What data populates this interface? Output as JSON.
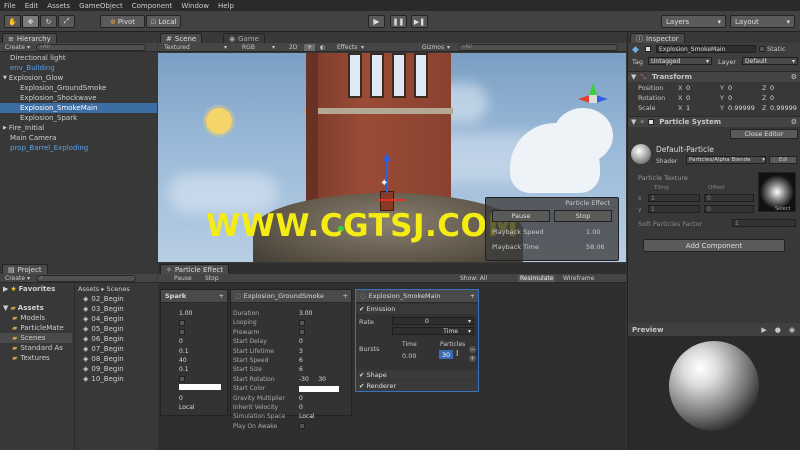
{
  "menu": [
    "File",
    "Edit",
    "Assets",
    "GameObject",
    "Component",
    "Window",
    "Help"
  ],
  "toolbar": {
    "pivot": "Pivot",
    "local": "Local",
    "layers": "Layers",
    "layout": "Layout"
  },
  "hierarchy": {
    "tab": "Hierarchy",
    "create": "Create",
    "search": "All",
    "items": [
      {
        "label": "Directional light",
        "indent": 0,
        "sel": false,
        "blue": false
      },
      {
        "label": "env_Building",
        "indent": 0,
        "sel": false,
        "blue": true
      },
      {
        "label": "Explosion_Glow",
        "indent": 0,
        "sel": false,
        "blue": false,
        "arrow": "▼"
      },
      {
        "label": "Explosion_GroundSmoke",
        "indent": 1,
        "sel": false,
        "blue": false
      },
      {
        "label": "Explosion_Shockwave",
        "indent": 1,
        "sel": false,
        "blue": false
      },
      {
        "label": "Explosion_SmokeMain",
        "indent": 1,
        "sel": true,
        "blue": false
      },
      {
        "label": "Explosion_Spark",
        "indent": 1,
        "sel": false,
        "blue": false
      },
      {
        "label": "Fire_Initial",
        "indent": 0,
        "sel": false,
        "blue": false,
        "arrow": "▶"
      },
      {
        "label": "Main Camera",
        "indent": 0,
        "sel": false,
        "blue": false
      },
      {
        "label": "prop_Barrel_Exploding",
        "indent": 0,
        "sel": false,
        "blue": true
      }
    ]
  },
  "scene": {
    "tab_scene": "Scene",
    "tab_game": "Game",
    "shading": "Textured",
    "render": "RGB",
    "mode2d": "2D",
    "effects": "Effects",
    "gizmos": "Gizmos",
    "search": "All",
    "watermark": "WWW.CGTSJ.COM",
    "overlay": {
      "title": "Particle Effect",
      "pause": "Pause",
      "stop": "Stop",
      "speed_label": "Playback Speed",
      "speed": "1.00",
      "time_label": "Playback Time",
      "time": "58.06"
    }
  },
  "project": {
    "tab": "Project",
    "create": "Create",
    "favorites": "Favorites",
    "assets": "Assets",
    "tree": [
      "Models",
      "ParticleMate",
      "Scenes",
      "Standard As",
      "Textures"
    ],
    "breadcrumb": "Assets ▸ Scenes",
    "scenes": [
      "02_Begin",
      "03_Begin",
      "04_Begin",
      "05_Begin",
      "06_Begin",
      "07_Begin",
      "08_Begin",
      "09_Begin",
      "10_Begin"
    ]
  },
  "particle": {
    "tab": "Particle Effect",
    "pause": "Pause",
    "stop": "Stop",
    "show": "Show: All",
    "resimulate": "Resimulate",
    "wireframe": "Wireframe",
    "spark": {
      "title": "Spark",
      "values": [
        "1.00",
        "",
        "",
        "0",
        "0.1",
        "40",
        "0.1",
        "",
        "0",
        "0",
        "Local"
      ]
    },
    "ground": {
      "title": "Explosion_GroundSmoke",
      "rows": [
        {
          "l": "Duration",
          "v": "3.00"
        },
        {
          "l": "Looping",
          "v": ""
        },
        {
          "l": "Prewarm",
          "v": ""
        },
        {
          "l": "Start Delay",
          "v": "0"
        },
        {
          "l": "Start Lifetime",
          "v": "3"
        },
        {
          "l": "Start Speed",
          "v": "6"
        },
        {
          "l": "Start Size",
          "v": "6"
        },
        {
          "l": "Start Rotation",
          "v": "-30     30"
        },
        {
          "l": "Start Color",
          "v": ""
        },
        {
          "l": "Gravity Multiplier",
          "v": "0"
        },
        {
          "l": "Inherit Velocity",
          "v": "0"
        },
        {
          "l": "Simulation Space",
          "v": "Local"
        },
        {
          "l": "Play On Awake",
          "v": ""
        }
      ]
    },
    "smoke": {
      "title": "Explosion_SmokeMain",
      "emission": "Emission",
      "rate_label": "Rate",
      "rate": "0",
      "rate_unit": "Time",
      "bursts": "Bursts",
      "time_hdr": "Time",
      "particles_hdr": "Particles",
      "burst_time": "0.00",
      "burst_count": "30",
      "shape": "Shape",
      "renderer": "Renderer"
    }
  },
  "inspector": {
    "tab": "Inspector",
    "name": "Explosion_SmokeMain",
    "static": "Static",
    "tag_label": "Tag",
    "tag": "Untagged",
    "layer_label": "Layer",
    "layer": "Default",
    "transform": "Transform",
    "position": {
      "label": "Position",
      "x": "0",
      "y": "0",
      "z": "0"
    },
    "rotation": {
      "label": "Rotation",
      "x": "0",
      "y": "0",
      "z": "0"
    },
    "scale": {
      "label": "Scale",
      "x": "1",
      "y": "0.99999",
      "z": "0.99999"
    },
    "ps": "Particle System",
    "close_editor": "Close Editor",
    "material": "Default-Particle",
    "shader_label": "Shader",
    "shader": "Particles/Alpha Blende",
    "edit": "Edi",
    "particle_texture": "Particle Texture",
    "tiling": "Tiling",
    "offset": "Offset",
    "tx": "1",
    "tox": "0",
    "ty": "1",
    "toy": "0",
    "select": "Select",
    "soft": "Soft Particles Factor",
    "soft_val": "1",
    "add_component": "Add Component"
  },
  "preview": {
    "tab": "Preview"
  }
}
